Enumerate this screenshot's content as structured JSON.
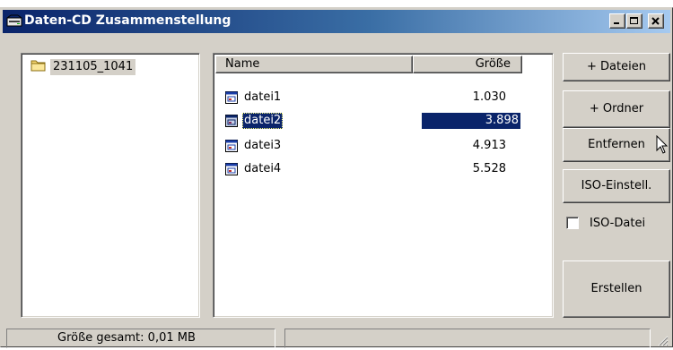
{
  "window": {
    "title": "Daten-CD Zusammenstellung",
    "controls": [
      "minimize",
      "maximize",
      "close"
    ]
  },
  "tree": {
    "items": [
      {
        "label": "231105_1041",
        "icon": "folder-icon"
      }
    ]
  },
  "file_list": {
    "columns": {
      "name": "Name",
      "size": "Größe"
    },
    "rows": [
      {
        "name": "datei1",
        "size": "1.030",
        "selected": false
      },
      {
        "name": "datei2",
        "size": "3.898",
        "selected": true
      },
      {
        "name": "datei3",
        "size": "4.913",
        "selected": false
      },
      {
        "name": "datei4",
        "size": "5.528",
        "selected": false
      }
    ]
  },
  "buttons": {
    "add_files": "+ Dateien",
    "add_folder": "+ Ordner",
    "remove": "Entfernen",
    "iso_settings": "ISO-Einstell.",
    "create": "Erstellen"
  },
  "iso_file": {
    "label": "ISO-Datei",
    "checked": false
  },
  "status": {
    "total_size": "Größe gesamt: 0,01 MB"
  },
  "colors": {
    "title_start": "#0a246a",
    "title_end": "#a6caf0",
    "selection": "#0a246a",
    "face": "#d4d0c8"
  }
}
